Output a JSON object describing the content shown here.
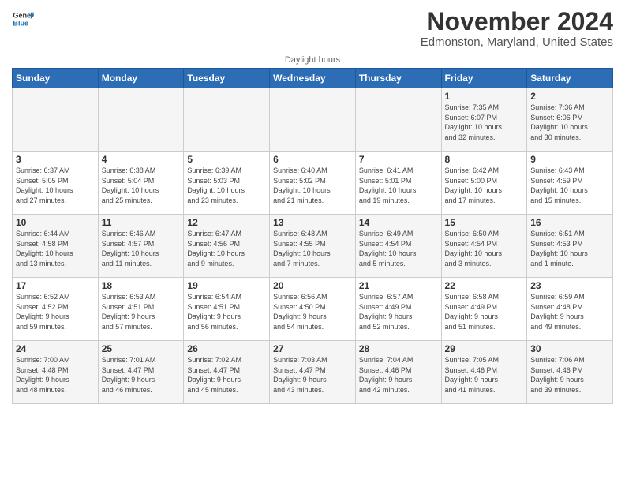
{
  "logo": {
    "text_general": "General",
    "text_blue": "Blue"
  },
  "title": "November 2024",
  "subtitle": "Edmonston, Maryland, United States",
  "daylight_note": "Daylight hours",
  "header_days": [
    "Sunday",
    "Monday",
    "Tuesday",
    "Wednesday",
    "Thursday",
    "Friday",
    "Saturday"
  ],
  "weeks": [
    [
      {
        "day": "",
        "info": ""
      },
      {
        "day": "",
        "info": ""
      },
      {
        "day": "",
        "info": ""
      },
      {
        "day": "",
        "info": ""
      },
      {
        "day": "",
        "info": ""
      },
      {
        "day": "1",
        "info": "Sunrise: 7:35 AM\nSunset: 6:07 PM\nDaylight: 10 hours\nand 32 minutes."
      },
      {
        "day": "2",
        "info": "Sunrise: 7:36 AM\nSunset: 6:06 PM\nDaylight: 10 hours\nand 30 minutes."
      }
    ],
    [
      {
        "day": "3",
        "info": "Sunrise: 6:37 AM\nSunset: 5:05 PM\nDaylight: 10 hours\nand 27 minutes."
      },
      {
        "day": "4",
        "info": "Sunrise: 6:38 AM\nSunset: 5:04 PM\nDaylight: 10 hours\nand 25 minutes."
      },
      {
        "day": "5",
        "info": "Sunrise: 6:39 AM\nSunset: 5:03 PM\nDaylight: 10 hours\nand 23 minutes."
      },
      {
        "day": "6",
        "info": "Sunrise: 6:40 AM\nSunset: 5:02 PM\nDaylight: 10 hours\nand 21 minutes."
      },
      {
        "day": "7",
        "info": "Sunrise: 6:41 AM\nSunset: 5:01 PM\nDaylight: 10 hours\nand 19 minutes."
      },
      {
        "day": "8",
        "info": "Sunrise: 6:42 AM\nSunset: 5:00 PM\nDaylight: 10 hours\nand 17 minutes."
      },
      {
        "day": "9",
        "info": "Sunrise: 6:43 AM\nSunset: 4:59 PM\nDaylight: 10 hours\nand 15 minutes."
      }
    ],
    [
      {
        "day": "10",
        "info": "Sunrise: 6:44 AM\nSunset: 4:58 PM\nDaylight: 10 hours\nand 13 minutes."
      },
      {
        "day": "11",
        "info": "Sunrise: 6:46 AM\nSunset: 4:57 PM\nDaylight: 10 hours\nand 11 minutes."
      },
      {
        "day": "12",
        "info": "Sunrise: 6:47 AM\nSunset: 4:56 PM\nDaylight: 10 hours\nand 9 minutes."
      },
      {
        "day": "13",
        "info": "Sunrise: 6:48 AM\nSunset: 4:55 PM\nDaylight: 10 hours\nand 7 minutes."
      },
      {
        "day": "14",
        "info": "Sunrise: 6:49 AM\nSunset: 4:54 PM\nDaylight: 10 hours\nand 5 minutes."
      },
      {
        "day": "15",
        "info": "Sunrise: 6:50 AM\nSunset: 4:54 PM\nDaylight: 10 hours\nand 3 minutes."
      },
      {
        "day": "16",
        "info": "Sunrise: 6:51 AM\nSunset: 4:53 PM\nDaylight: 10 hours\nand 1 minute."
      }
    ],
    [
      {
        "day": "17",
        "info": "Sunrise: 6:52 AM\nSunset: 4:52 PM\nDaylight: 9 hours\nand 59 minutes."
      },
      {
        "day": "18",
        "info": "Sunrise: 6:53 AM\nSunset: 4:51 PM\nDaylight: 9 hours\nand 57 minutes."
      },
      {
        "day": "19",
        "info": "Sunrise: 6:54 AM\nSunset: 4:51 PM\nDaylight: 9 hours\nand 56 minutes."
      },
      {
        "day": "20",
        "info": "Sunrise: 6:56 AM\nSunset: 4:50 PM\nDaylight: 9 hours\nand 54 minutes."
      },
      {
        "day": "21",
        "info": "Sunrise: 6:57 AM\nSunset: 4:49 PM\nDaylight: 9 hours\nand 52 minutes."
      },
      {
        "day": "22",
        "info": "Sunrise: 6:58 AM\nSunset: 4:49 PM\nDaylight: 9 hours\nand 51 minutes."
      },
      {
        "day": "23",
        "info": "Sunrise: 6:59 AM\nSunset: 4:48 PM\nDaylight: 9 hours\nand 49 minutes."
      }
    ],
    [
      {
        "day": "24",
        "info": "Sunrise: 7:00 AM\nSunset: 4:48 PM\nDaylight: 9 hours\nand 48 minutes."
      },
      {
        "day": "25",
        "info": "Sunrise: 7:01 AM\nSunset: 4:47 PM\nDaylight: 9 hours\nand 46 minutes."
      },
      {
        "day": "26",
        "info": "Sunrise: 7:02 AM\nSunset: 4:47 PM\nDaylight: 9 hours\nand 45 minutes."
      },
      {
        "day": "27",
        "info": "Sunrise: 7:03 AM\nSunset: 4:47 PM\nDaylight: 9 hours\nand 43 minutes."
      },
      {
        "day": "28",
        "info": "Sunrise: 7:04 AM\nSunset: 4:46 PM\nDaylight: 9 hours\nand 42 minutes."
      },
      {
        "day": "29",
        "info": "Sunrise: 7:05 AM\nSunset: 4:46 PM\nDaylight: 9 hours\nand 41 minutes."
      },
      {
        "day": "30",
        "info": "Sunrise: 7:06 AM\nSunset: 4:46 PM\nDaylight: 9 hours\nand 39 minutes."
      }
    ]
  ]
}
